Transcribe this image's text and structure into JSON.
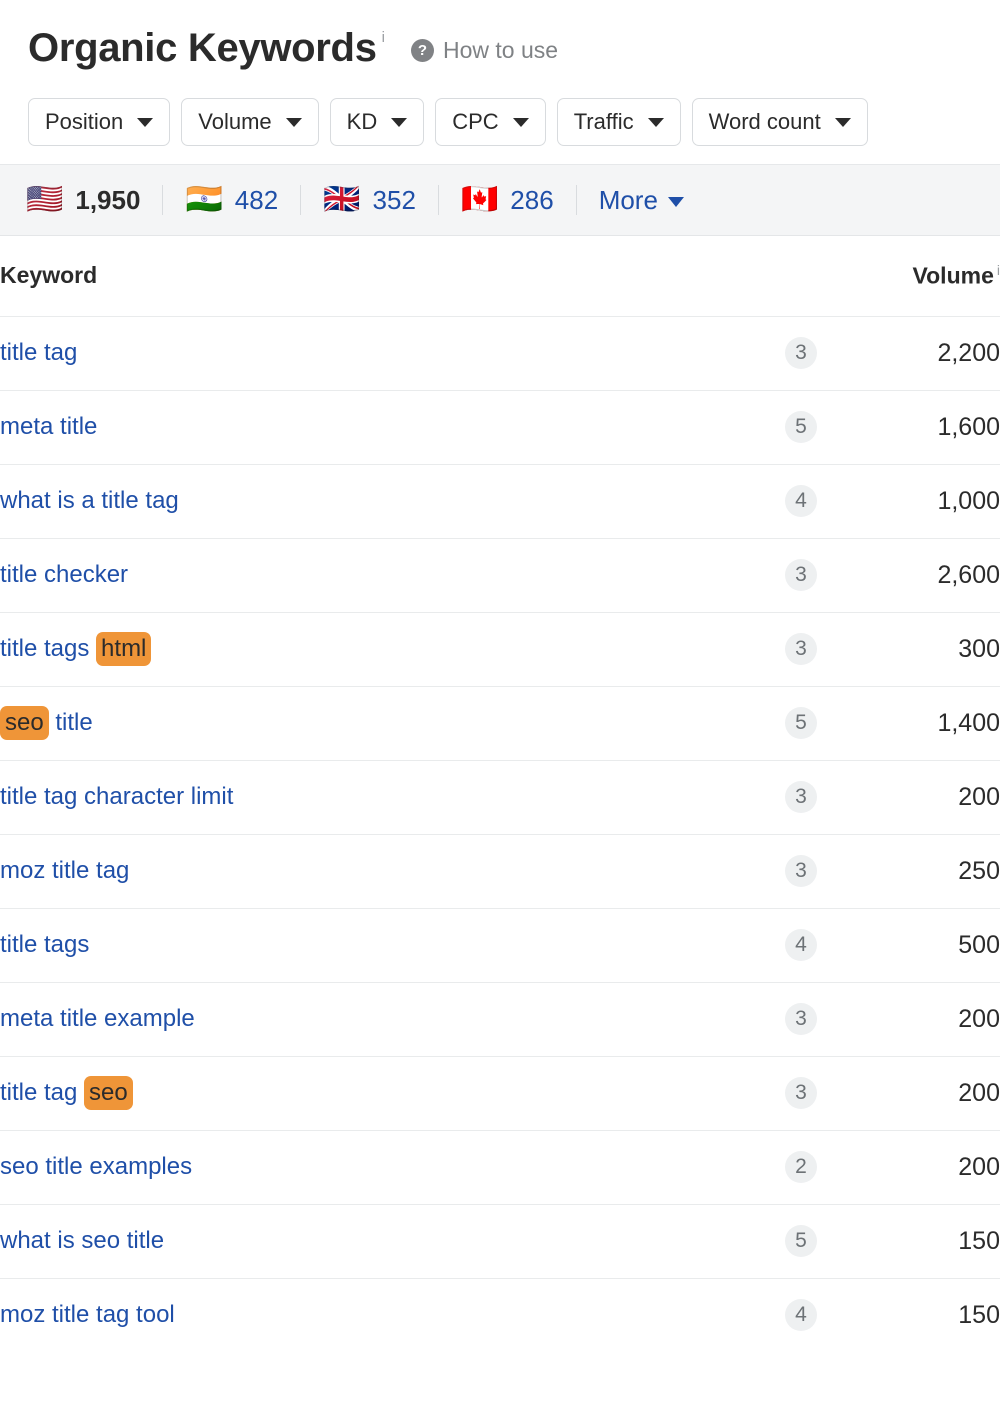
{
  "header": {
    "title": "Organic Keywords",
    "title_info_marker": "i",
    "help_icon": "question-mark-icon",
    "help_label": "How to use"
  },
  "filters": [
    {
      "label": "Position",
      "icon": "chevron-down-icon"
    },
    {
      "label": "Volume",
      "icon": "chevron-down-icon"
    },
    {
      "label": "KD",
      "icon": "chevron-down-icon"
    },
    {
      "label": "CPC",
      "icon": "chevron-down-icon"
    },
    {
      "label": "Traffic",
      "icon": "chevron-down-icon"
    },
    {
      "label": "Word count",
      "icon": "chevron-down-icon"
    }
  ],
  "countries": [
    {
      "flag": "🇺🇸",
      "name": "united-states",
      "count": "1,950",
      "active": true
    },
    {
      "flag": "🇮🇳",
      "name": "india",
      "count": "482",
      "active": false
    },
    {
      "flag": "🇬🇧",
      "name": "united-kingdom",
      "count": "352",
      "active": false
    },
    {
      "flag": "🇨🇦",
      "name": "canada",
      "count": "286",
      "active": false
    }
  ],
  "more_label": "More",
  "table": {
    "columns": {
      "keyword": "Keyword",
      "position": "",
      "volume": "Volume",
      "volume_info_marker": "i"
    },
    "rows": [
      {
        "keyword": "title tag",
        "parts": [
          {
            "t": "title tag",
            "h": false
          }
        ],
        "position": "3",
        "volume": "2,200"
      },
      {
        "keyword": "meta title",
        "parts": [
          {
            "t": "meta title",
            "h": false
          }
        ],
        "position": "5",
        "volume": "1,600"
      },
      {
        "keyword": "what is a title tag",
        "parts": [
          {
            "t": "what is a title tag",
            "h": false
          }
        ],
        "position": "4",
        "volume": "1,000"
      },
      {
        "keyword": "title checker",
        "parts": [
          {
            "t": "title checker",
            "h": false
          }
        ],
        "position": "3",
        "volume": "2,600"
      },
      {
        "keyword": "title tags html",
        "parts": [
          {
            "t": "title tags ",
            "h": false
          },
          {
            "t": "html",
            "h": true
          }
        ],
        "position": "3",
        "volume": "300"
      },
      {
        "keyword": "seo title",
        "parts": [
          {
            "t": "seo",
            "h": true
          },
          {
            "t": " title",
            "h": false
          }
        ],
        "position": "5",
        "volume": "1,400"
      },
      {
        "keyword": "title tag character limit",
        "parts": [
          {
            "t": "title tag character limit",
            "h": false
          }
        ],
        "position": "3",
        "volume": "200"
      },
      {
        "keyword": "moz title tag",
        "parts": [
          {
            "t": "moz title tag",
            "h": false
          }
        ],
        "position": "3",
        "volume": "250"
      },
      {
        "keyword": "title tags",
        "parts": [
          {
            "t": "title tags",
            "h": false
          }
        ],
        "position": "4",
        "volume": "500"
      },
      {
        "keyword": "meta title example",
        "parts": [
          {
            "t": "meta title example",
            "h": false
          }
        ],
        "position": "3",
        "volume": "200"
      },
      {
        "keyword": "title tag seo",
        "parts": [
          {
            "t": "title tag ",
            "h": false
          },
          {
            "t": "seo",
            "h": true
          }
        ],
        "position": "3",
        "volume": "200"
      },
      {
        "keyword": "seo title examples",
        "parts": [
          {
            "t": "seo title examples",
            "h": false
          }
        ],
        "position": "2",
        "volume": "200"
      },
      {
        "keyword": "what is seo title",
        "parts": [
          {
            "t": "what is seo title",
            "h": false
          }
        ],
        "position": "5",
        "volume": "150"
      },
      {
        "keyword": "moz title tag tool",
        "parts": [
          {
            "t": "moz title tag tool",
            "h": false
          }
        ],
        "position": "4",
        "volume": "150"
      }
    ]
  },
  "colors": {
    "link": "#1f4fa8",
    "highlight": "#ef9538",
    "text": "#2b2b2b",
    "muted": "#7f8285",
    "badge_bg": "#eef0f1",
    "bar_bg": "#f4f5f6"
  }
}
